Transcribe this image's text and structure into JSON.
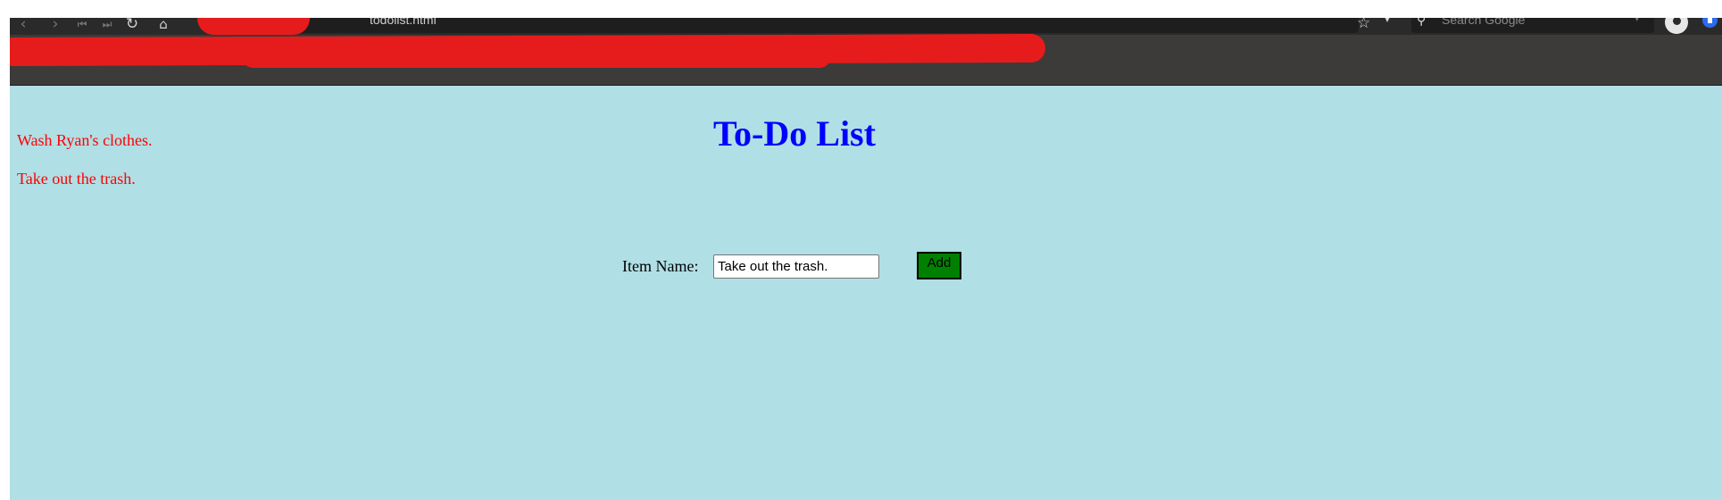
{
  "browser": {
    "url_text": "todolist.html",
    "search_placeholder": "Search Google",
    "icons": {
      "back": "back-arrow-icon",
      "forward": "forward-arrow-icon",
      "first": "skip-start-icon",
      "last": "skip-end-icon",
      "reload": "reload-icon",
      "home": "home-icon",
      "shield": "shield-icon",
      "bookmark": "bookmark-star-icon",
      "search": "search-icon",
      "account": "account-icon",
      "extension": "extension-icon"
    },
    "colors": {
      "toolbar": "#2b2a2a",
      "bookmarks_bar": "#3c3b39",
      "redaction": "#e61c1c"
    }
  },
  "page": {
    "title": "To-Do List",
    "background": "#b0dfe5",
    "title_color": "#0000ff",
    "item_color": "#ff0000",
    "items": [
      "Wash Ryan's clothes.",
      "Take out the trash."
    ],
    "form": {
      "label": "Item Name:",
      "input_value": "Take out the trash.",
      "button_label": "Add",
      "button_color": "#008000"
    }
  }
}
